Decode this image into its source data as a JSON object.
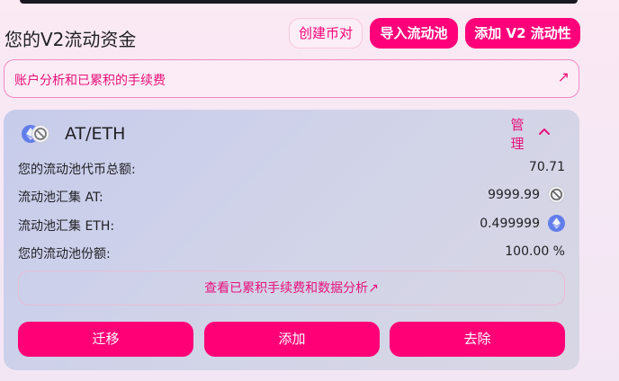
{
  "page": {
    "title": "您的V2流动资金",
    "create_pair_label": "创建币对",
    "import_pool_label": "导入流动池",
    "add_v2_label": "添加 V2 流动性"
  },
  "analytics_banner": {
    "label": "账户分析和已累积的手续费",
    "arrow": "↗"
  },
  "position": {
    "pair": "AT/ETH",
    "manage_label": "管理",
    "rows": [
      {
        "label": "您的流动池代币总额:",
        "value": "70.71"
      },
      {
        "label": "流动池汇集 AT:",
        "value": "9999.99",
        "icon": "at-token-icon"
      },
      {
        "label": "流动池汇集 ETH:",
        "value": "0.499999",
        "icon": "eth-token-icon"
      },
      {
        "label": "您的流动池份额:",
        "value": "100.00 %"
      }
    ],
    "fees_link_label": "查看已累积手续费和数据分析↗",
    "actions": [
      "迁移",
      "添加",
      "去除"
    ]
  },
  "colors": {
    "accent": "#ff007a",
    "eth_blue": "#627eea"
  }
}
